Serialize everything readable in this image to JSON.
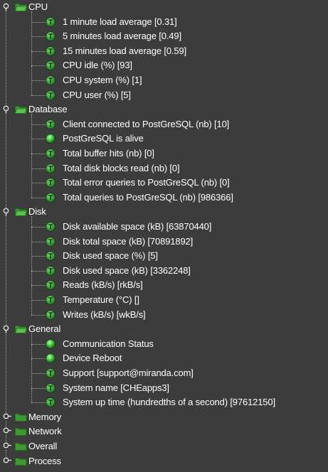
{
  "tree": [
    {
      "label": "CPU",
      "expanded": true,
      "children": [
        {
          "icon": "threshold",
          "label": "1 minute load average [0.31]"
        },
        {
          "icon": "threshold",
          "label": "5 minutes load average [0.49]"
        },
        {
          "icon": "threshold",
          "label": "15 minutes load average [0.59]"
        },
        {
          "icon": "threshold",
          "label": "CPU idle (%) [93]"
        },
        {
          "icon": "threshold",
          "label": "CPU system (%) [1]"
        },
        {
          "icon": "threshold",
          "label": "CPU user (%) [5]"
        }
      ]
    },
    {
      "label": "Database",
      "expanded": true,
      "children": [
        {
          "icon": "threshold",
          "label": "Client connected to PostGreSQL (nb) [10]"
        },
        {
          "icon": "status",
          "label": "PostGreSQL is alive"
        },
        {
          "icon": "threshold",
          "label": "Total buffer hits (nb) [0]"
        },
        {
          "icon": "threshold",
          "label": "Total disk blocks read (nb) [0]"
        },
        {
          "icon": "threshold",
          "label": "Total error queries to PostGreSQL (nb) [0]"
        },
        {
          "icon": "threshold",
          "label": "Total queries to PostGreSQL (nb) [986366]"
        }
      ]
    },
    {
      "label": "Disk",
      "expanded": true,
      "children": [
        {
          "icon": "threshold",
          "label": "Disk available space (kB) [63870440]"
        },
        {
          "icon": "threshold",
          "label": "Disk total space (kB) [70891892]"
        },
        {
          "icon": "threshold",
          "label": "Disk used space (%) [5]"
        },
        {
          "icon": "threshold",
          "label": "Disk used space (kB) [3362248]"
        },
        {
          "icon": "threshold",
          "label": "Reads (kB/s) [rkB/s]"
        },
        {
          "icon": "threshold",
          "label": "Temperature (°C) []"
        },
        {
          "icon": "threshold",
          "label": "Writes (kB/s) [wkB/s]"
        }
      ]
    },
    {
      "label": "General",
      "expanded": true,
      "children": [
        {
          "icon": "status",
          "label": "Communication Status"
        },
        {
          "icon": "status",
          "label": "Device Reboot"
        },
        {
          "icon": "threshold",
          "label": "Support [support@miranda.com]"
        },
        {
          "icon": "threshold",
          "label": "System name [CHEapps3]"
        },
        {
          "icon": "threshold",
          "label": "System up time (hundredths of a second) [97612150]"
        }
      ]
    },
    {
      "label": "Memory",
      "expanded": false,
      "children": []
    },
    {
      "label": "Network",
      "expanded": false,
      "children": []
    },
    {
      "label": "Overall",
      "expanded": false,
      "children": []
    },
    {
      "label": "Process",
      "expanded": false,
      "children": []
    }
  ],
  "icons": {
    "threshold": {
      "name": "threshold-t-icon",
      "glyph": "T",
      "color": "#2f9e2f"
    },
    "status": {
      "name": "status-green-light-icon",
      "color": "#3ebf3a"
    }
  },
  "colors": {
    "background": "#3c3c3c",
    "text": "#ffffff",
    "folder": "#3d9a32",
    "connector": "#a8a8a8"
  }
}
